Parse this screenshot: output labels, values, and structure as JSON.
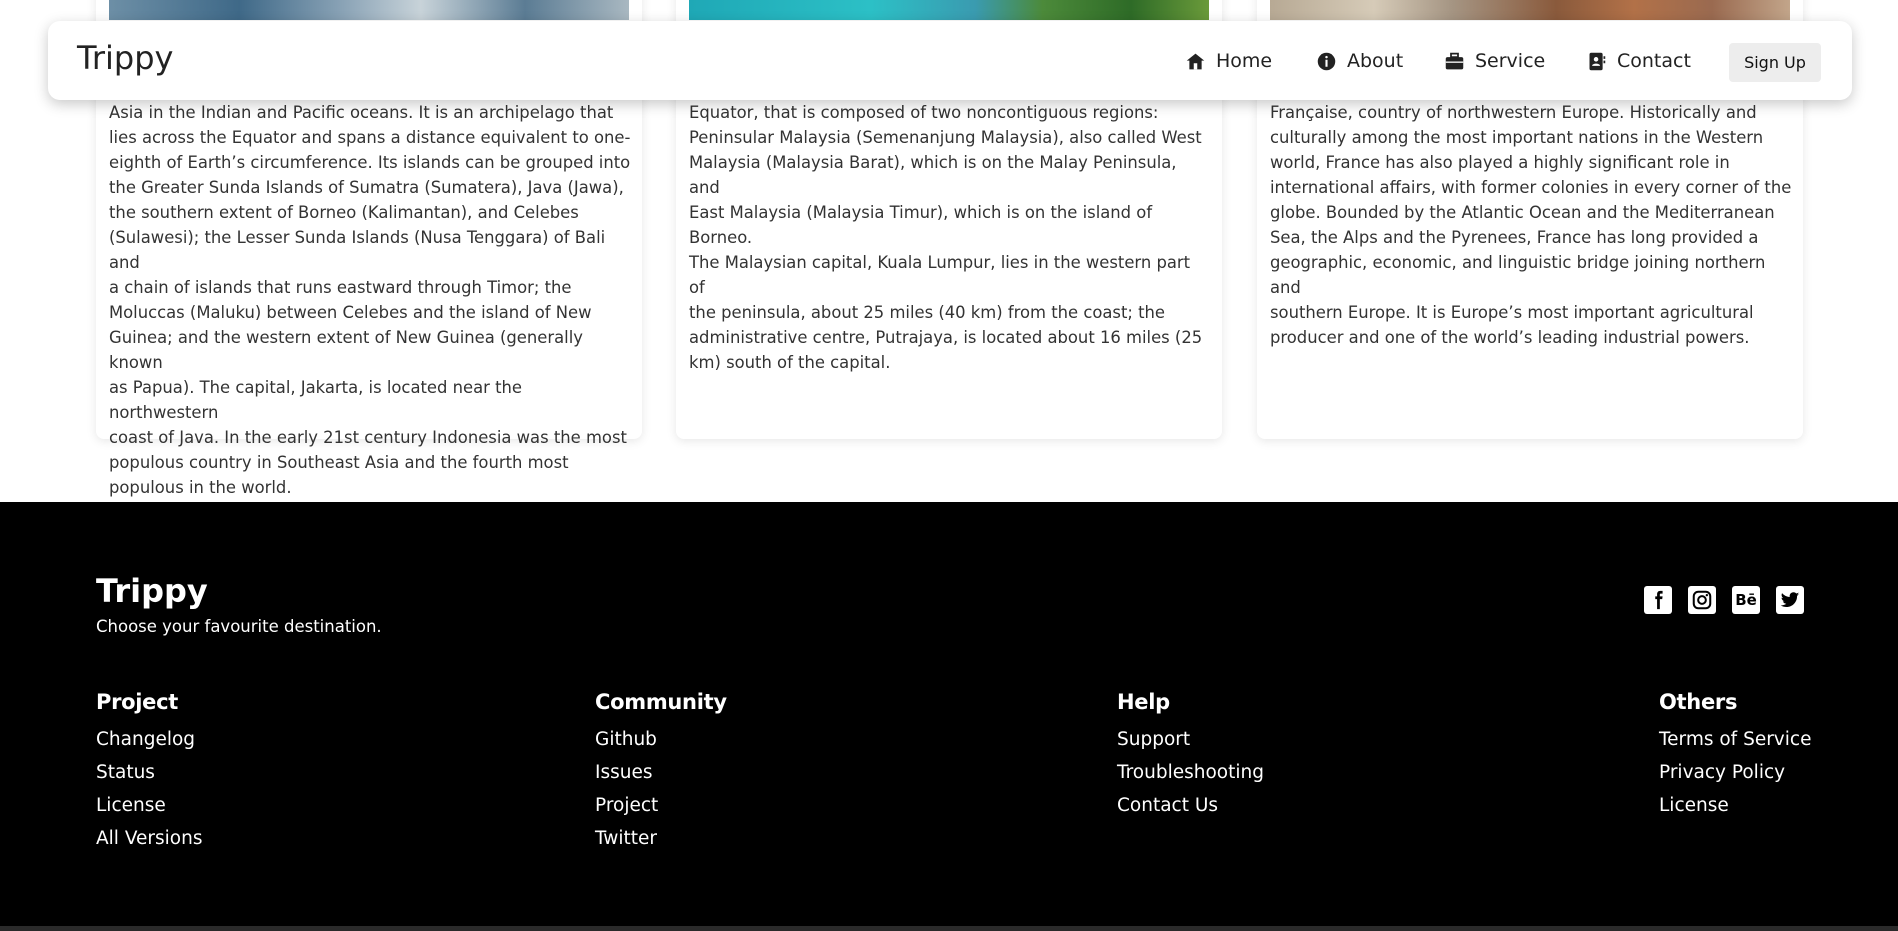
{
  "navbar": {
    "brand": "Trippy",
    "items": [
      {
        "label": "Home",
        "icon": "home-icon"
      },
      {
        "label": "About",
        "icon": "info-icon"
      },
      {
        "label": "Service",
        "icon": "briefcase-icon"
      },
      {
        "label": "Contact",
        "icon": "contact-card-icon"
      }
    ],
    "signup_label": "Sign Up"
  },
  "cards": [
    {
      "image": "indonesia-image",
      "lines": [
        "Asia in the Indian and Pacific oceans. It is an archipelago that",
        "lies across the Equator and spans a distance equivalent to one-",
        "eighth of Earth’s circumference. Its islands can be grouped into",
        "the Greater Sunda Islands of Sumatra (Sumatera), Java (Jawa),",
        "the southern extent of Borneo (Kalimantan), and Celebes",
        "(Sulawesi); the Lesser Sunda Islands (Nusa Tenggara) of Bali and",
        "a chain of islands that runs eastward through Timor; the",
        "Moluccas (Maluku) between Celebes and the island of New",
        "Guinea; and the western extent of New Guinea (generally known",
        "as Papua). The capital, Jakarta, is located near the northwestern",
        "coast of Java. In the early 21st century Indonesia was the most",
        "populous country in Southeast Asia and the fourth most",
        "populous in the world."
      ]
    },
    {
      "image": "malaysia-image",
      "lines": [
        "Equator, that is composed of two noncontiguous regions:",
        "Peninsular Malaysia (Semenanjung Malaysia), also called West",
        "Malaysia (Malaysia Barat), which is on the Malay Peninsula, and",
        "East Malaysia (Malaysia Timur), which is on the island of Borneo.",
        "The Malaysian capital, Kuala Lumpur, lies in the western part of",
        "the peninsula, about 25 miles (40 km) from the coast; the",
        "administrative centre, Putrajaya, is located about 16 miles (25",
        "km) south of the capital."
      ]
    },
    {
      "image": "france-image",
      "lines": [
        "Française, country of northwestern Europe. Historically and",
        "culturally among the most important nations in the Western",
        "world, France has also played a highly significant role in",
        "international affairs, with former colonies in every corner of the",
        "globe. Bounded by the Atlantic Ocean and the Mediterranean",
        "Sea, the Alps and the Pyrenees, France has long provided a",
        "geographic, economic, and linguistic bridge joining northern and",
        "southern Europe. It is Europe’s most important agricultural",
        "producer and one of the world’s leading industrial powers."
      ]
    }
  ],
  "footer": {
    "brand": "Trippy",
    "tagline": "Choose your favourite destination.",
    "socials": [
      {
        "icon": "facebook-icon",
        "glyph": "f"
      },
      {
        "icon": "instagram-icon",
        "glyph": ""
      },
      {
        "icon": "behance-icon",
        "glyph": "Bē"
      },
      {
        "icon": "twitter-icon",
        "glyph": ""
      }
    ],
    "columns": [
      {
        "title": "Project",
        "links": [
          "Changelog",
          "Status",
          "License",
          "All Versions"
        ]
      },
      {
        "title": "Community",
        "links": [
          "Github",
          "Issues",
          "Project",
          "Twitter"
        ]
      },
      {
        "title": "Help",
        "links": [
          "Support",
          "Troubleshooting",
          "Contact Us"
        ]
      },
      {
        "title": "Others",
        "links": [
          "Terms of Service",
          "Privacy Policy",
          "License"
        ]
      }
    ]
  }
}
